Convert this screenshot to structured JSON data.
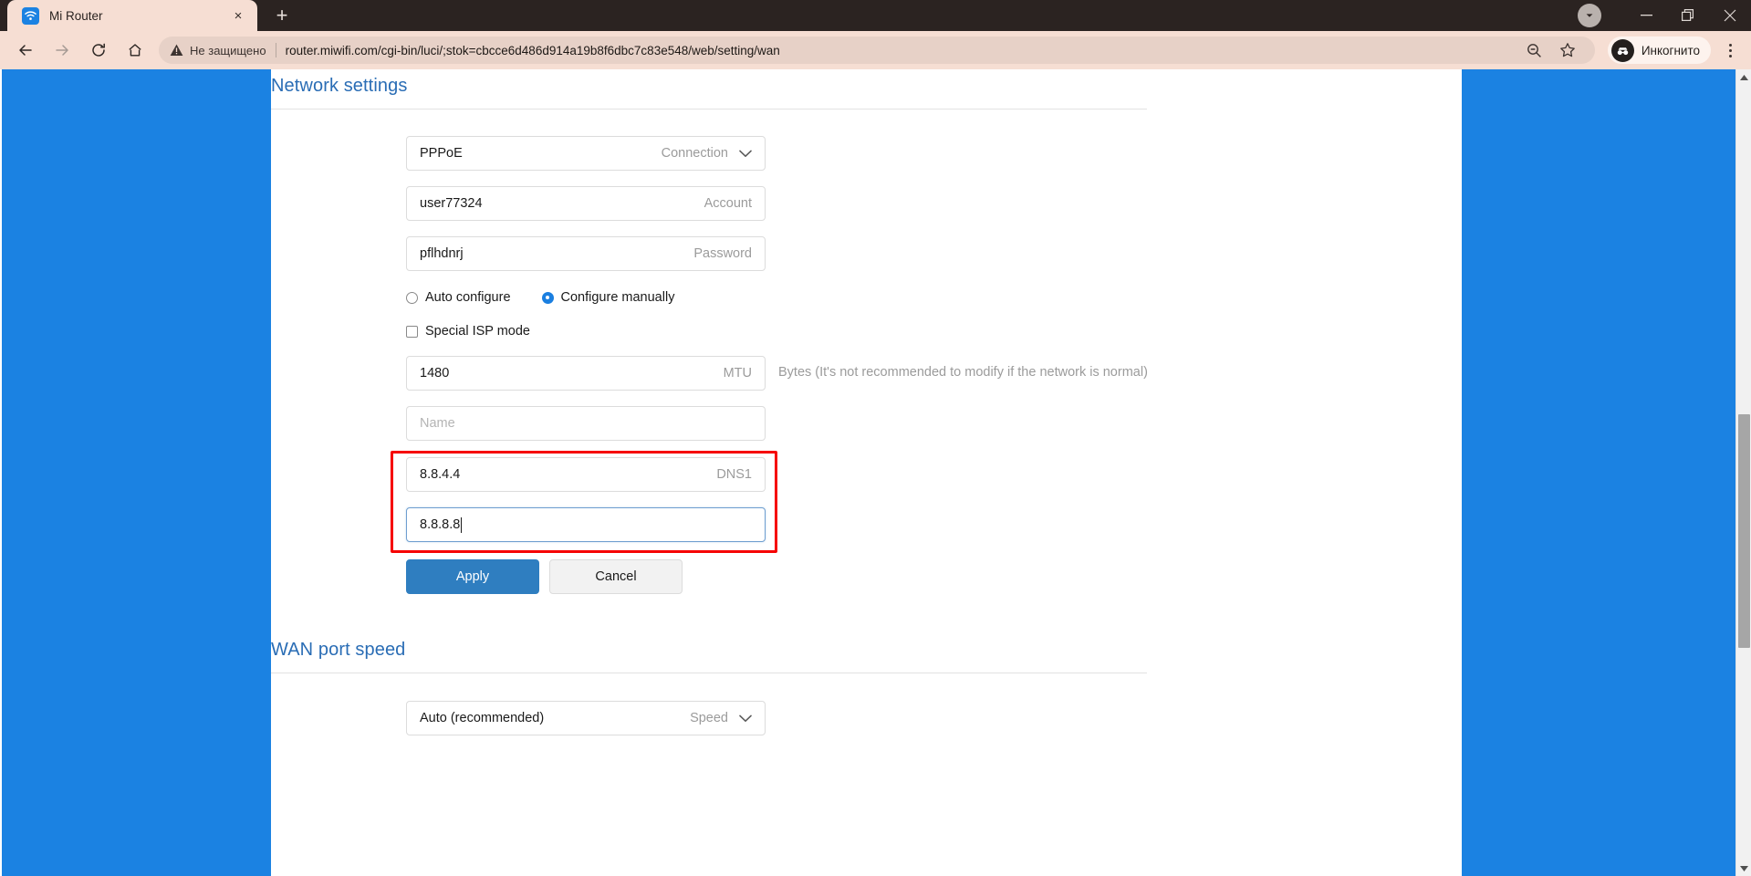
{
  "browser": {
    "tab": {
      "title": "Mi Router",
      "favicon": "wifi-icon",
      "close": "×"
    },
    "new_tab_label": "+",
    "window_controls": {
      "download": "download-chevron-icon",
      "minimize": "—",
      "maximize": "restore-icon",
      "close": "✕"
    },
    "nav": {
      "back": "back-arrow-icon",
      "forward": "forward-arrow-icon",
      "reload": "reload-icon",
      "home": "home-icon"
    },
    "omnibox": {
      "security_label": "Не защищено",
      "security_icon": "warning-triangle-icon",
      "url": "router.miwifi.com/cgi-bin/luci/;stok=cbcce6d486d914a19b8f6dbc7c83e548/web/setting/wan"
    },
    "toolbar_icons": {
      "zoom_out": "zoom-out-icon",
      "bookmark": "star-icon",
      "menu": "three-dot-menu-icon"
    },
    "profile": {
      "label": "Инкогнито",
      "icon": "incognito-icon"
    }
  },
  "page": {
    "network_settings": {
      "title": "Network settings",
      "connection": {
        "value": "PPPoE",
        "label": "Connection",
        "icon": "chevron-down-icon"
      },
      "account": {
        "value": "user77324",
        "label": "Account"
      },
      "password": {
        "value": "pflhdnrj",
        "label": "Password"
      },
      "config_mode": {
        "auto": {
          "label": "Auto configure",
          "checked": false
        },
        "manual": {
          "label": "Configure manually",
          "checked": true
        }
      },
      "special_isp": {
        "label": "Special ISP mode",
        "checked": false
      },
      "mtu": {
        "value": "1480",
        "label": "MTU",
        "hint": "Bytes (It's not recommended to modify if the network is normal)"
      },
      "name": {
        "value": "",
        "placeholder": "Name"
      },
      "dns1": {
        "value": "8.8.4.4",
        "label": "DNS1"
      },
      "dns2": {
        "value": "8.8.8.8",
        "label": "",
        "focused": true
      },
      "apply_button": "Apply",
      "cancel_button": "Cancel"
    },
    "wan_port_speed": {
      "title": "WAN port speed",
      "speed": {
        "value": "Auto (recommended)",
        "label": "Speed",
        "icon": "chevron-down-icon"
      }
    }
  },
  "colors": {
    "accent_blue": "#1b82e2",
    "link_blue": "#2a6db5",
    "button_blue": "#2f7ec0",
    "highlight_red": "#f60202",
    "chrome_bg": "#f6ded3"
  }
}
